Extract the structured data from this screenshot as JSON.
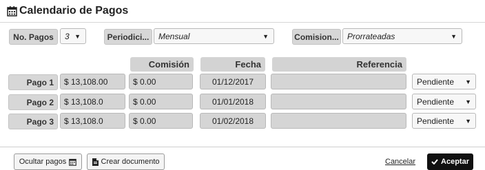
{
  "dialog": {
    "title": "Calendario de Pagos"
  },
  "header": {
    "payments_label": "No. Pagos",
    "payments_value": "3",
    "period_label": "Periodici...",
    "period_value": "Mensual",
    "commission_label": "Comision...",
    "commission_value": "Prorrateadas"
  },
  "table": {
    "columns": {
      "commission": "Comisión",
      "date": "Fecha",
      "reference": "Referencia"
    },
    "rows": [
      {
        "label": "Pago 1",
        "amount": "$ 13,108.00",
        "commission": "$ 0.00",
        "date": "01/12/2017",
        "reference": "",
        "status": "Pendiente"
      },
      {
        "label": "Pago 2",
        "amount": "$ 13,108.0",
        "commission": "$ 0.00",
        "date": "01/01/2018",
        "reference": "",
        "status": "Pendiente"
      },
      {
        "label": "Pago 3",
        "amount": "$ 13,108.0",
        "commission": "$ 0.00",
        "date": "01/02/2018",
        "reference": "",
        "status": "Pendiente"
      }
    ]
  },
  "footer": {
    "hide_payments": "Ocultar pagos",
    "create_document": "Crear documento",
    "cancel": "Cancelar",
    "accept": "Aceptar"
  },
  "icons": {
    "title": "calendar-icon",
    "hide": "calendar-icon",
    "document": "document-icon",
    "accept": "check-icon",
    "dropdown": "caret-down-icon"
  }
}
